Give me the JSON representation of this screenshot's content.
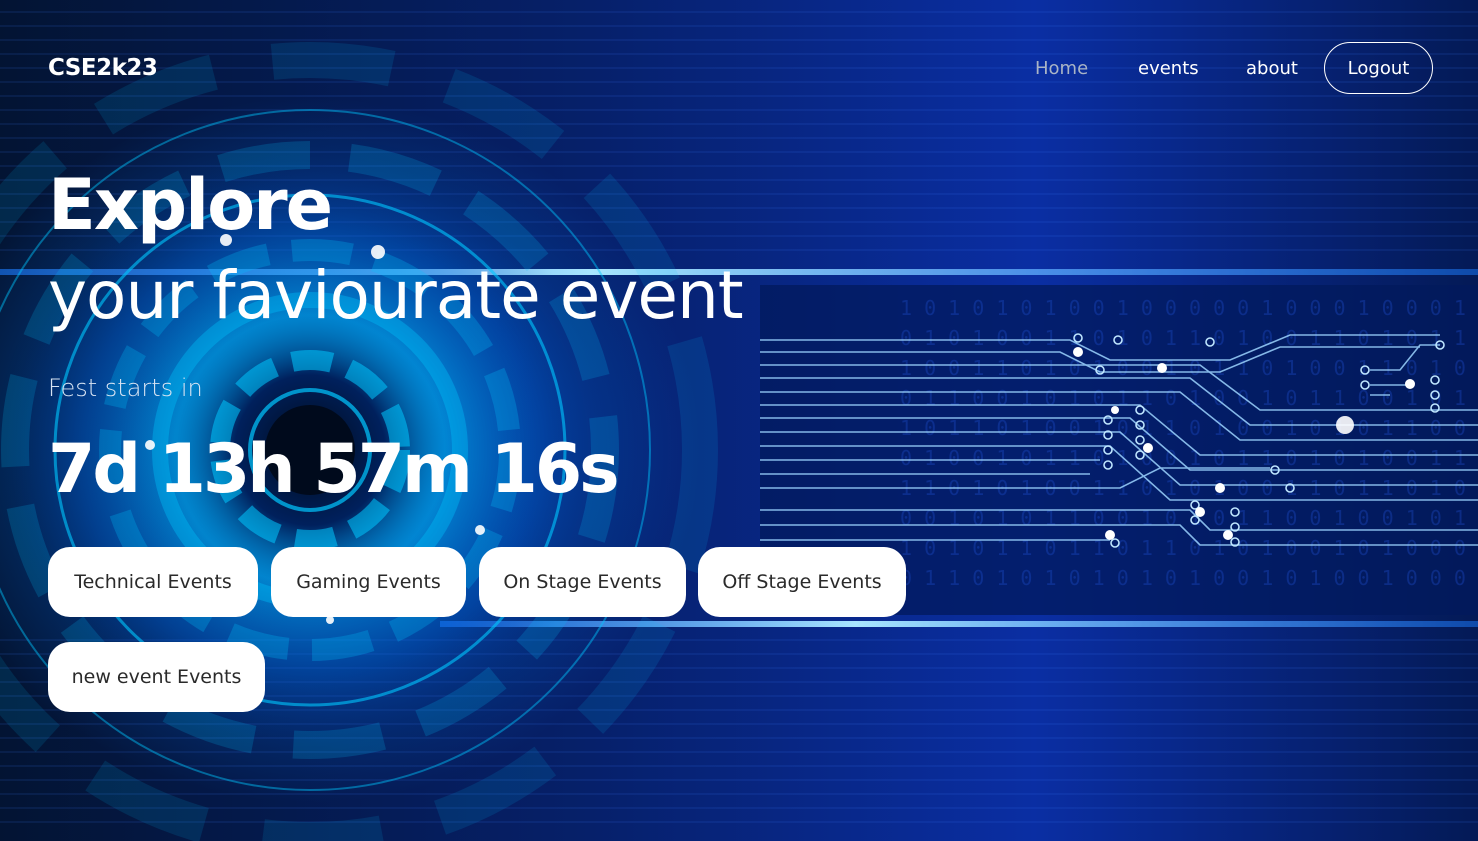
{
  "navbar": {
    "brand": "CSE2k23",
    "links": [
      {
        "label": "Home",
        "active": true
      },
      {
        "label": "events",
        "active": false
      },
      {
        "label": "about",
        "active": false
      }
    ],
    "logout_label": "Logout"
  },
  "hero": {
    "title": "Explore",
    "subtitle": "your faviourate event",
    "fest_label": "Fest starts in",
    "countdown": "7d 13h 57m 16s"
  },
  "categories": [
    {
      "label": "Technical Events"
    },
    {
      "label": "Gaming Events"
    },
    {
      "label": "On Stage Events"
    },
    {
      "label": "Off Stage Events"
    },
    {
      "label": "new event Events"
    }
  ],
  "colors": {
    "background_dark": "#020a24",
    "background_blue": "#0a2ea3",
    "glow_cyan": "#00aaff",
    "text_primary": "#ffffff",
    "nav_home": "#a9b4c6",
    "button_bg": "#ffffff",
    "button_text": "#2a2a2a"
  }
}
